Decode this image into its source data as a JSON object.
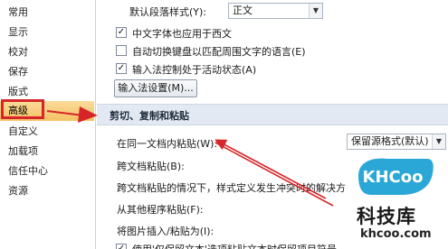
{
  "sidebar": {
    "items": [
      {
        "label": "常用"
      },
      {
        "label": "显示"
      },
      {
        "label": "校对"
      },
      {
        "label": "保存"
      },
      {
        "label": "版式"
      },
      {
        "label": "高级"
      },
      {
        "label": "自定义"
      },
      {
        "label": "加载项"
      },
      {
        "label": "信任中心"
      },
      {
        "label": "资源"
      }
    ],
    "selected_index": 5
  },
  "main": {
    "default_para_style": {
      "label": "默认段落样式(Y):",
      "value": "正文"
    },
    "options": [
      {
        "label": "中文字体也应用于西文",
        "checked": true
      },
      {
        "label": "自动切换键盘以匹配周围文字的语言(E)",
        "checked": false
      },
      {
        "label": "输入法控制处于活动状态(A)",
        "checked": true
      }
    ],
    "ime_button": "输入法设置(M)...",
    "section_title": "剪切、复制和粘贴",
    "paste_rows": [
      {
        "label": "在同一文档内粘贴(W):",
        "value": "保留源格式(默认)"
      },
      {
        "label": "跨文档粘贴(B):"
      },
      {
        "label": "跨文档粘贴的情况下，样式定义发生冲突时的解决方"
      },
      {
        "label": "从其他程序粘贴(F):"
      },
      {
        "label": "将图片插入/粘贴为(I):"
      },
      {
        "label": "使用'仅保留文本'选项粘贴文本时保留项目符号"
      }
    ]
  },
  "watermark": {
    "badge": "KHCoo",
    "name": "科技库",
    "url": "khcoo.com"
  },
  "colors": {
    "annotation_red": "#d7262a",
    "selected_nav": "#f5c264",
    "section_header": "#e3e9f2"
  }
}
